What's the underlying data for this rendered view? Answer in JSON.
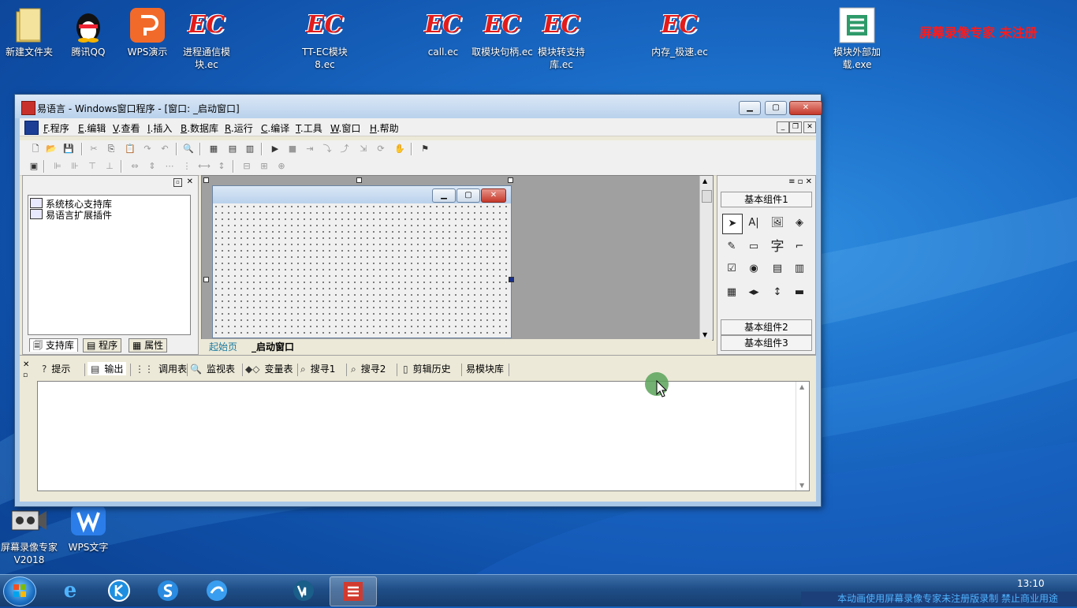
{
  "desktop": {
    "icons": [
      {
        "label": "新建文件夹",
        "icon": "folder-icon"
      },
      {
        "label": "腾讯QQ",
        "icon": "qq-penguin-icon"
      },
      {
        "label": "WPS演示",
        "icon": "wps-presentation-icon"
      },
      {
        "label": "进程通信模块.ec",
        "icon": "ec-module-icon"
      },
      {
        "label": "TT-EC模块8.ec",
        "icon": "ec-module-icon"
      },
      {
        "label": "call.ec",
        "icon": "ec-module-icon"
      },
      {
        "label": "取模块句柄.ec",
        "icon": "ec-module-icon"
      },
      {
        "label": "模块转支持库.ec",
        "icon": "ec-module-icon"
      },
      {
        "label": "内存_极速.ec",
        "icon": "ec-module-icon"
      },
      {
        "label": "模块外部加载.exe",
        "icon": "exe-icon"
      },
      {
        "label": "屏幕录像专家V2018",
        "icon": "screen-recorder-icon"
      },
      {
        "label": "WPS文字",
        "icon": "wps-writer-icon"
      }
    ],
    "ec_logo_text": "EC",
    "watermark_top": "屏幕录像专家  未注册"
  },
  "window": {
    "title": "易语言 - Windows窗口程序 - [窗口: _启动窗口]",
    "controls": {
      "minimize": "▁",
      "maximize": "▢",
      "close": "✕"
    }
  },
  "menu": [
    {
      "key": "F",
      "label": ".程序"
    },
    {
      "key": "E",
      "label": ".编辑"
    },
    {
      "key": "V",
      "label": ".查看"
    },
    {
      "key": "I",
      "label": ".插入"
    },
    {
      "key": "B",
      "label": ".数据库"
    },
    {
      "key": "R",
      "label": ".运行"
    },
    {
      "key": "C",
      "label": ".编译"
    },
    {
      "key": "T",
      "label": ".工具"
    },
    {
      "key": "W",
      "label": ".窗口"
    },
    {
      "key": "H",
      "label": ".帮助"
    }
  ],
  "support_panel": {
    "items": [
      "系统核心支持库",
      "易语言扩展插件"
    ],
    "tabs": [
      "支持库",
      "程序",
      "属性"
    ]
  },
  "designer": {
    "tabs": [
      "起始页",
      "_启动窗口"
    ]
  },
  "components": {
    "groups": [
      "基本组件1",
      "基本组件2",
      "基本组件3"
    ],
    "char_label": "字"
  },
  "output": {
    "tabs": [
      "提示",
      "输出",
      "调用表",
      "监视表",
      "变量表",
      "搜寻1",
      "搜寻2",
      "剪辑历史",
      "易模块库"
    ]
  },
  "taskbar": {
    "clock": "13:10",
    "watermark": "本动画使用屏幕录像专家未注册版录制  禁止商业用途"
  }
}
